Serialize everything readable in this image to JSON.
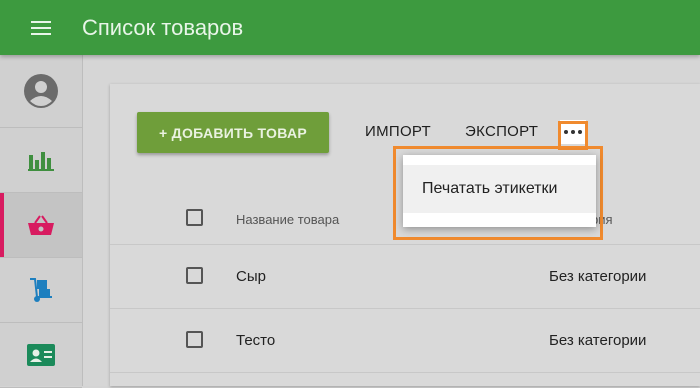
{
  "header": {
    "title": "Список товаров",
    "menu_icon": "hamburger-menu-icon"
  },
  "sidebar": {
    "items": [
      {
        "icon": "account-circle-icon",
        "active": false
      },
      {
        "icon": "bar-chart-icon",
        "active": false
      },
      {
        "icon": "shopping-basket-icon",
        "active": true
      },
      {
        "icon": "hand-truck-icon",
        "active": false
      },
      {
        "icon": "contact-card-icon",
        "active": false
      }
    ]
  },
  "toolbar": {
    "add_label": "+ ДОБАВИТЬ ТОВАР",
    "import_label": "ИМПОРТ",
    "export_label": "ЭКСПОРТ",
    "more_icon": "more-horizontal-icon"
  },
  "table": {
    "columns": [
      "Название товара",
      "рия"
    ],
    "rows": [
      {
        "name": "Сыр",
        "category": "Без категории"
      },
      {
        "name": "Тесто",
        "category": "Без категории"
      }
    ]
  },
  "dropdown": {
    "items": [
      "Печатать этикетки"
    ]
  },
  "colors": {
    "topbar": "#3d9a3f",
    "add_button": "#6f9e3a",
    "highlight": "#f08a2e",
    "active_indicator": "#d81b60"
  }
}
